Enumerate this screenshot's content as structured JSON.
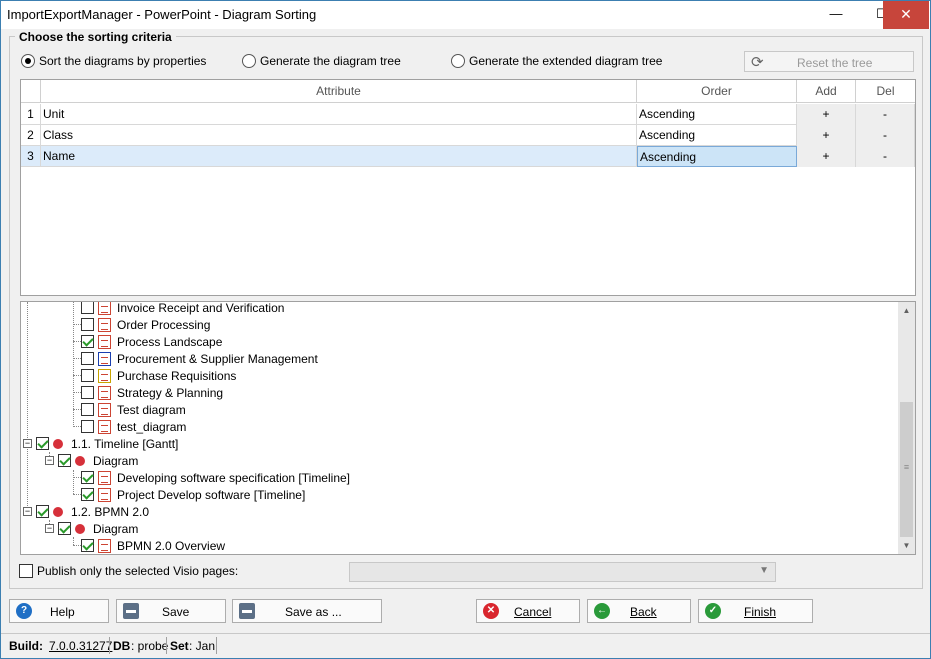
{
  "window": {
    "title": "ImportExportManager - PowerPoint - Diagram Sorting",
    "min_glyph": "—",
    "max_glyph": "☐",
    "close_glyph": "✕"
  },
  "group_title": "Choose the sorting criteria",
  "radios": [
    {
      "label": "Sort the diagrams by properties",
      "selected": true
    },
    {
      "label": "Generate the diagram tree",
      "selected": false
    },
    {
      "label": "Generate the extended diagram tree",
      "selected": false
    }
  ],
  "reset_button": {
    "label": "Reset the tree",
    "icon": "refresh-icon"
  },
  "grid": {
    "headers": {
      "attribute": "Attribute",
      "order": "Order",
      "add": "Add",
      "del": "Del"
    },
    "rows": [
      {
        "num": "1",
        "attribute": "Unit",
        "order": "Ascending",
        "add": "+",
        "del": "-"
      },
      {
        "num": "2",
        "attribute": "Class",
        "order": "Ascending",
        "add": "+",
        "del": "-"
      },
      {
        "num": "3",
        "attribute": "Name",
        "order": "Ascending",
        "add": "+",
        "del": "-"
      }
    ]
  },
  "tree": {
    "items": [
      {
        "label": "Invoice Receipt and Verification",
        "checked": false,
        "kind": "diagram"
      },
      {
        "label": "Order Processing",
        "checked": false,
        "kind": "diagram"
      },
      {
        "label": "Process Landscape",
        "checked": true,
        "kind": "diagram"
      },
      {
        "label": "Procurement & Supplier Management",
        "checked": false,
        "kind": "diagram"
      },
      {
        "label": "Purchase Requisitions",
        "checked": false,
        "kind": "diagram"
      },
      {
        "label": "Strategy & Planning",
        "checked": false,
        "kind": "diagram"
      },
      {
        "label": "Test diagram",
        "checked": false,
        "kind": "diagram"
      },
      {
        "label": "test_diagram",
        "checked": false,
        "kind": "diagram"
      },
      {
        "label": "1.1. Timeline [Gantt]",
        "checked": true,
        "kind": "group"
      },
      {
        "label": "Diagram",
        "checked": true,
        "kind": "folder"
      },
      {
        "label": "Developing software specification [Timeline]",
        "checked": true,
        "kind": "diagram"
      },
      {
        "label": "Project Develop software [Timeline]",
        "checked": true,
        "kind": "diagram"
      },
      {
        "label": "1.2. BPMN 2.0",
        "checked": true,
        "kind": "group"
      },
      {
        "label": "Diagram",
        "checked": true,
        "kind": "folder"
      },
      {
        "label": "BPMN 2.0 Overview",
        "checked": true,
        "kind": "diagram"
      }
    ]
  },
  "publish_label": "Publish only the selected Visio pages:",
  "buttons": {
    "help": "Help",
    "save": "Save",
    "save_as": "Save as ...",
    "cancel": "Cancel",
    "back": "Back",
    "finish": "Finish"
  },
  "status": {
    "build_label": "Build:",
    "build_value": "7.0.0.31277",
    "db_label": "DB",
    "db_value": ": probe",
    "set_label": "Set",
    "set_value": ": Jan"
  },
  "colors": {
    "help": "#1f6fc5",
    "cancel": "#d9262e",
    "back": "#2a9a3a",
    "finish": "#2a9a3a"
  }
}
